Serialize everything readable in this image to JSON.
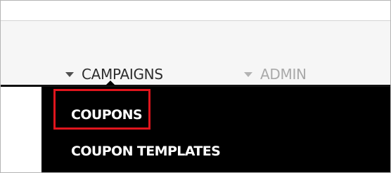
{
  "nav": {
    "items": [
      {
        "label": "CAMPAIGNS",
        "active": true
      },
      {
        "label": "ADMIN",
        "active": false
      }
    ]
  },
  "dropdown": {
    "items": [
      {
        "label": "COUPONS",
        "highlighted": true
      },
      {
        "label": "COUPON TEMPLATES",
        "highlighted": false
      }
    ]
  },
  "colors": {
    "dropdown_background": "#000000",
    "highlight_border": "#e0151d",
    "active_nav_text": "#2e2e2e",
    "inactive_nav_text": "#a9a9a9"
  },
  "icons": [
    "caret-down-icon",
    "caret-down-icon"
  ]
}
